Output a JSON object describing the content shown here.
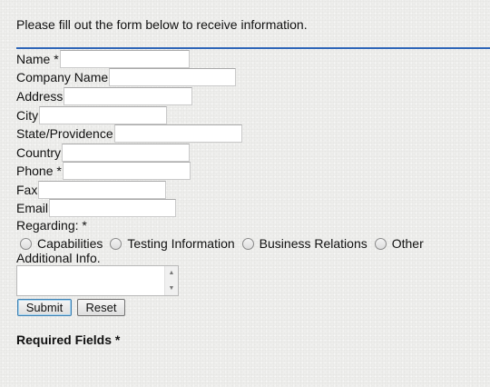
{
  "intro_text": "Please fill out the form below to receive information.",
  "accent_color": "#2f66b8",
  "fields": {
    "name": {
      "label": "Name *",
      "value": ""
    },
    "company": {
      "label": "Company Name",
      "value": ""
    },
    "address": {
      "label": "Address",
      "value": ""
    },
    "city": {
      "label": "City",
      "value": ""
    },
    "state": {
      "label": "State/Providence",
      "value": ""
    },
    "country": {
      "label": "Country",
      "value": ""
    },
    "phone": {
      "label": "Phone *",
      "value": ""
    },
    "fax": {
      "label": "Fax",
      "value": ""
    },
    "email": {
      "label": "Email",
      "value": ""
    }
  },
  "regarding": {
    "label": "Regarding: *",
    "options": [
      {
        "label": "Capabilities",
        "selected": false
      },
      {
        "label": "Testing Information",
        "selected": false
      },
      {
        "label": "Business Relations",
        "selected": false
      },
      {
        "label": "Other",
        "selected": false
      }
    ]
  },
  "additional_info": {
    "label": "Additional Info.",
    "value": ""
  },
  "icons": {
    "scroll_up": "scroll-up-arrow",
    "scroll_down": "scroll-down-arrow"
  },
  "buttons": {
    "submit": "Submit",
    "reset": "Reset"
  },
  "required_note": "Required Fields *"
}
